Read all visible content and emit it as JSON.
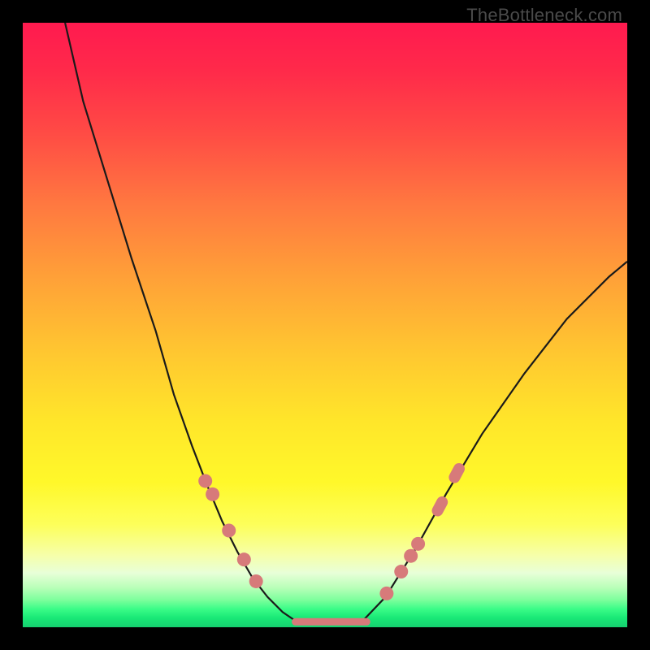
{
  "watermark": "TheBottleneck.com",
  "colors": {
    "background": "#000000",
    "gradient_top": "#ff1a4f",
    "gradient_bottom": "#16d070",
    "curve": "#1a1a1a",
    "bead": "#d77a7a"
  },
  "chart_data": {
    "type": "line",
    "title": "",
    "xlabel": "",
    "ylabel": "",
    "xlim": [
      0,
      100
    ],
    "ylim": [
      0,
      100
    ],
    "grid": false,
    "legend": false,
    "note": "Values estimated from pixel positions relative to the 744x744 plot area. Y represents height above bottom (0 at bottom, 100 at top).",
    "series": [
      {
        "name": "left-curve",
        "x": [
          7,
          10,
          14,
          18,
          22,
          25,
          28,
          30.5,
          33,
          35.5,
          38,
          40.5,
          43,
          45.5
        ],
        "y": [
          100,
          87,
          74,
          61,
          49,
          38.5,
          30,
          23.5,
          17.5,
          12.5,
          8.2,
          5,
          2.5,
          0.8
        ]
      },
      {
        "name": "floor",
        "x": [
          45.5,
          56
        ],
        "y": [
          0.8,
          0.8
        ]
      },
      {
        "name": "right-curve",
        "x": [
          56,
          60,
          65,
          70,
          76,
          83,
          90,
          97,
          100
        ],
        "y": [
          0.8,
          5,
          13,
          22,
          32,
          42,
          51,
          58,
          60.5
        ]
      }
    ],
    "markers": {
      "name": "beads",
      "style": "round",
      "color": "#d77a7a",
      "points": [
        {
          "x": 30.2,
          "y": 24.2,
          "kind": "dot"
        },
        {
          "x": 31.4,
          "y": 22.0,
          "kind": "dot"
        },
        {
          "x": 34.1,
          "y": 16.0,
          "kind": "dot"
        },
        {
          "x": 36.6,
          "y": 11.2,
          "kind": "dot"
        },
        {
          "x": 38.6,
          "y": 7.6,
          "kind": "dot"
        },
        {
          "x": 60.2,
          "y": 5.6,
          "kind": "dot"
        },
        {
          "x": 62.6,
          "y": 9.2,
          "kind": "dot"
        },
        {
          "x": 64.2,
          "y": 11.8,
          "kind": "dot"
        },
        {
          "x": 65.4,
          "y": 13.8,
          "kind": "dot"
        },
        {
          "x": 69.0,
          "y": 20.0,
          "kind": "pill"
        },
        {
          "x": 71.8,
          "y": 25.5,
          "kind": "pill"
        }
      ],
      "floor_segment": {
        "x_start": 44.5,
        "x_end": 57.5,
        "y": 0.9
      }
    }
  }
}
